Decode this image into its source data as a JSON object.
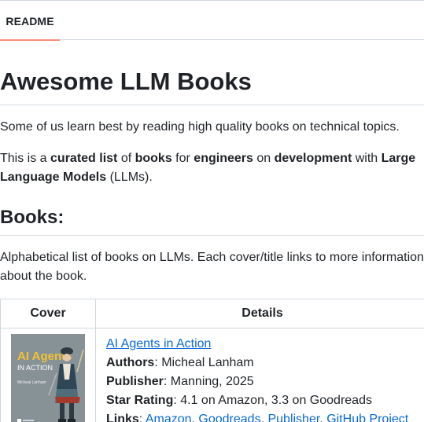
{
  "tabs": {
    "readme": "README"
  },
  "readme": {
    "title": "Awesome LLM Books",
    "intro": "Some of us learn best by reading high quality books on technical topics.",
    "p2": {
      "a": "This is a ",
      "b": "curated list",
      "c": " of ",
      "d": "books",
      "e": " for ",
      "f": "engineers",
      "g": " on ",
      "h": "development",
      "i": " with ",
      "j": "Large Language Models",
      "k": " (LLMs)."
    },
    "books_heading": "Books:",
    "books_intro": "Alphabetical list of books on LLMs. Each cover/title links to more information about the book."
  },
  "table": {
    "headers": [
      "Cover",
      "Details"
    ],
    "rows": [
      {
        "cover_text": {
          "line1": "AI Agents",
          "line2": "IN ACTION",
          "author": "Micheal Lanham"
        },
        "title": "AI Agents in Action",
        "authors_label": "Authors",
        "authors": "Micheal Lanham",
        "publisher_label": "Publisher",
        "publisher": "Manning, 2025",
        "rating_label": "Star Rating",
        "rating": "4.1 on Amazon, 3.3 on Goodreads",
        "links_label": "Links",
        "links": [
          "Amazon",
          "Goodreads",
          "Publisher",
          "GitHub Project"
        ]
      }
    ]
  }
}
